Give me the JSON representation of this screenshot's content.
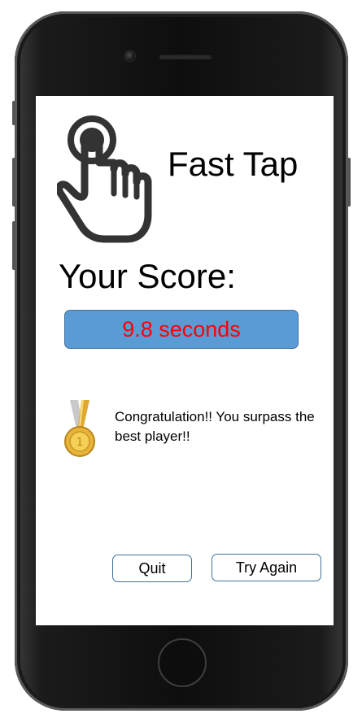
{
  "app": {
    "title": "Fast Tap"
  },
  "score": {
    "label": "Your Score:",
    "value": "9.8 seconds"
  },
  "message": {
    "text": "Congratulation!! You surpass the best player!!"
  },
  "buttons": {
    "quit": "Quit",
    "try_again": "Try Again"
  },
  "icons": {
    "app_icon": "tap-hand-icon",
    "award": "gold-medal-icon"
  },
  "colors": {
    "score_box": "#5b9bd5",
    "score_text": "#ff0000",
    "button_border": "#41719c",
    "medal_gold": "#e8b53a",
    "ribbon": "#c9c9c9"
  }
}
